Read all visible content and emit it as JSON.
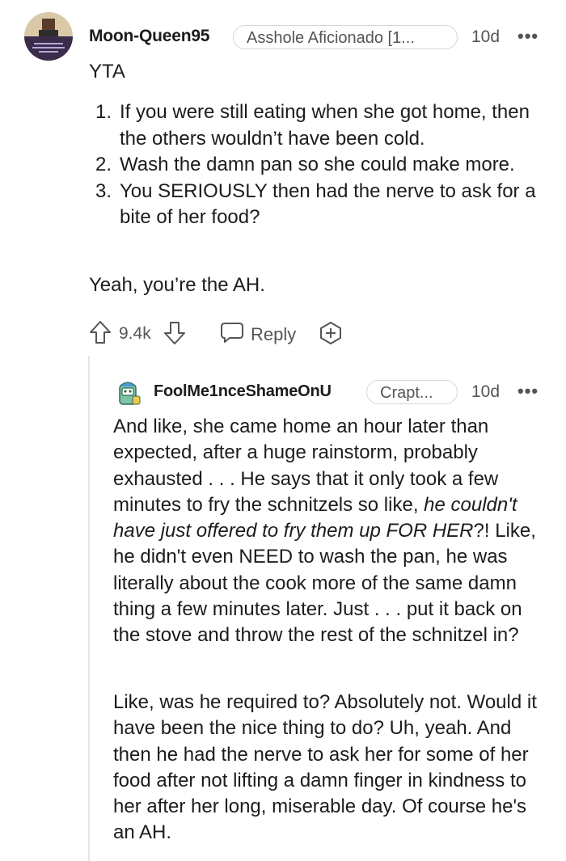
{
  "comment": {
    "username": "Moon-Queen95",
    "flair": "Asshole Aficionado [1...",
    "time": "10d",
    "more": "•••",
    "verdict": "YTA",
    "points": [
      {
        "num": "1.",
        "text": "If you were still eating when she got home, then the others wouldn’t have been cold."
      },
      {
        "num": "2.",
        "text": "Wash the damn pan so she could make more."
      },
      {
        "num": "3.",
        "text": "You SERIOUSLY then had the nerve to ask for a bite of her food?"
      }
    ],
    "closing": "Yeah, you’re the AH.",
    "votes": "9.4k",
    "reply_label": "Reply"
  },
  "reply": {
    "username": "FoolMe1nceShameOnU",
    "flair": "Crapt...",
    "time": "10d",
    "more": "•••",
    "p1_a": "And like, she came home an hour later than expected, after a huge rainstorm, probably exhausted . . . He says that it only took a few minutes to fry the schnitzels so like, ",
    "p1_em": "he couldn't have just offered to fry them up FOR HER",
    "p1_b": "?! Like, he didn't even NEED to wash the pan, he was literally about the cook more of the same damn thing a few minutes later. Just . . . put it back on the stove and throw the rest of the schnitzel in?",
    "p2": "Like, was he required to? Absolutely not. Would it have been the nice thing to do? Uh, yeah. And then he had the nerve to ask her for some of her food after not lifting a damn finger in kindness to her after her long, miserable day. Of course he's an AH."
  }
}
